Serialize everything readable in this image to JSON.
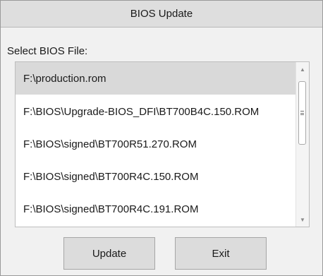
{
  "window": {
    "title": "BIOS Update"
  },
  "select_label": "Select BIOS File:",
  "file_list": {
    "selected_index": 0,
    "items": [
      {
        "label": "F:\\production.rom"
      },
      {
        "label": "F:\\BIOS\\Upgrade-BIOS_DFI\\BT700B4C.150.ROM"
      },
      {
        "label": "F:\\BIOS\\signed\\BT700R51.270.ROM"
      },
      {
        "label": "F:\\BIOS\\signed\\BT700R4C.150.ROM"
      },
      {
        "label": "F:\\BIOS\\signed\\BT700R4C.191.ROM"
      }
    ]
  },
  "scrollbar": {
    "up_icon": "triangle-up",
    "down_icon": "triangle-down",
    "thumb_icon": "grip-lines",
    "up_glyph": "▲",
    "down_glyph": "▼"
  },
  "buttons": {
    "update_label": "Update",
    "exit_label": "Exit"
  },
  "colors": {
    "selected_row": "#d9d9d9",
    "titlebar": "#dedede",
    "button_face": "#dcdcdc"
  }
}
